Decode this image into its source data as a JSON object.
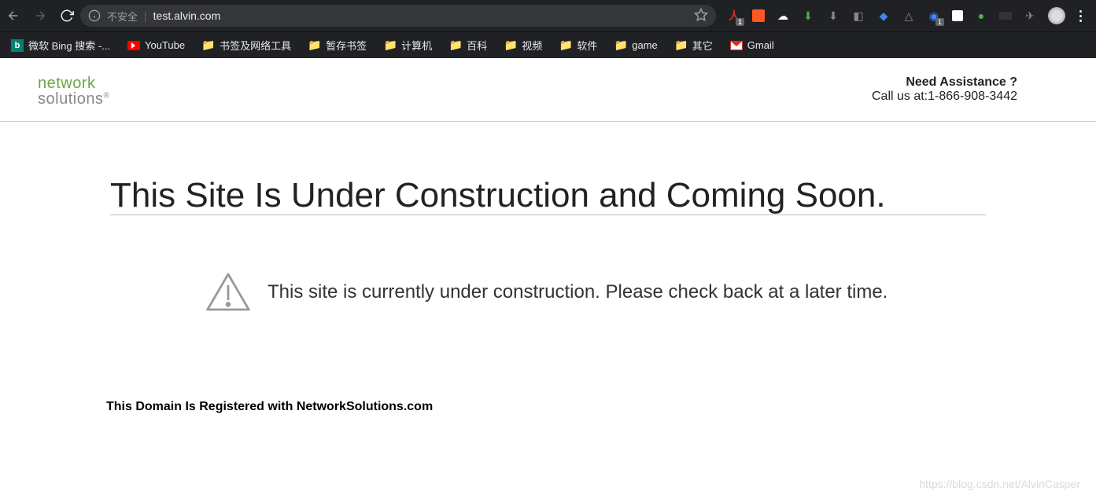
{
  "browser": {
    "unsafe_label": "不安全",
    "url": "test.alvin.com",
    "ext_badge": "1"
  },
  "bookmarks": [
    {
      "label": "微软 Bing 搜索 -...",
      "icon": "bing"
    },
    {
      "label": "YouTube",
      "icon": "youtube"
    },
    {
      "label": "书签及网络工具",
      "icon": "folder"
    },
    {
      "label": "暂存书签",
      "icon": "folder"
    },
    {
      "label": "计算机",
      "icon": "folder"
    },
    {
      "label": "百科",
      "icon": "folder"
    },
    {
      "label": "视频",
      "icon": "folder"
    },
    {
      "label": "软件",
      "icon": "folder"
    },
    {
      "label": "game",
      "icon": "folder"
    },
    {
      "label": "其它",
      "icon": "folder"
    },
    {
      "label": "Gmail",
      "icon": "gmail"
    }
  ],
  "logo": {
    "top": "network",
    "bottom": "solutions"
  },
  "assist": {
    "title": "Need Assistance ?",
    "call": "Call us at:1-866-908-3442"
  },
  "main": {
    "headline": "This Site Is Under Construction and Coming Soon.",
    "message": "This site is currently under construction. Please check back at a later time.",
    "registered": "This Domain Is Registered with NetworkSolutions.com"
  },
  "watermark": "https://blog.csdn.net/AlvinCasper"
}
